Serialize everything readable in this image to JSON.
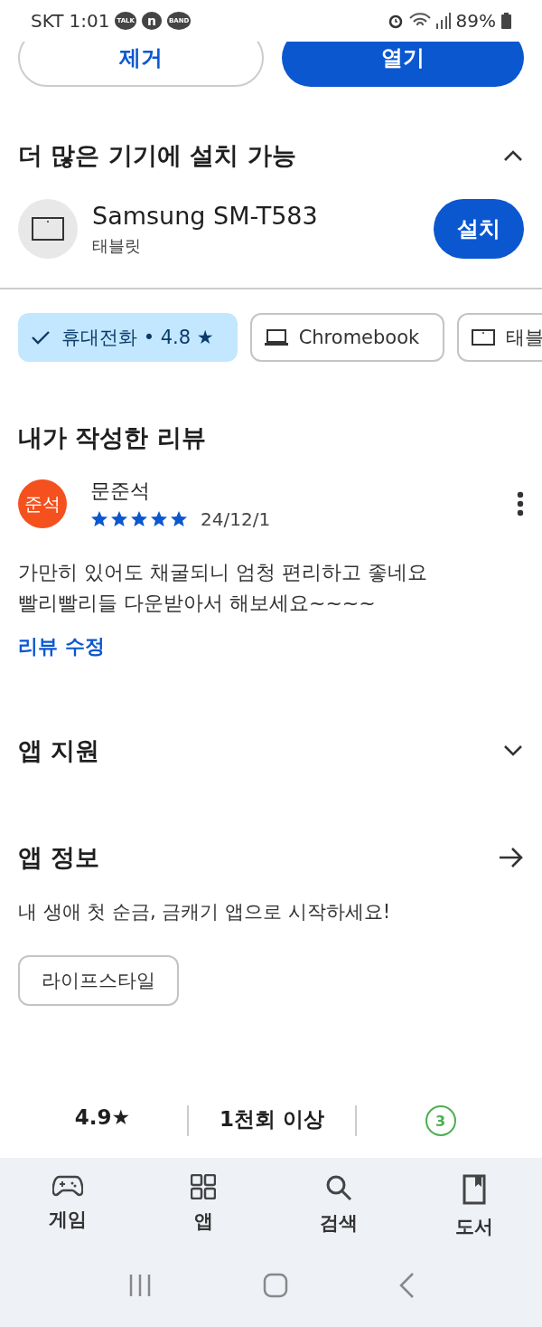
{
  "status_bar": {
    "carrier": "SKT",
    "time": "1:01",
    "notifications": [
      "TALK",
      "n",
      "BAND"
    ],
    "battery": "89%"
  },
  "action_buttons": [
    {
      "label": "제거",
      "kind": "outline"
    },
    {
      "label": "열기",
      "kind": "filled"
    }
  ],
  "devices_section": {
    "title": "더 많은 기기에 설치 가능",
    "expanded": true,
    "devices": [
      {
        "name": "Samsung SM-T583",
        "type": "태블릿",
        "button": "설치"
      }
    ]
  },
  "device_chips": [
    {
      "label": "휴대전화 • 4.8 ★",
      "selected": true
    },
    {
      "label": "Chromebook",
      "kind": "laptop",
      "selected": false
    },
    {
      "label": "태블",
      "kind": "tablet",
      "selected": false
    }
  ],
  "my_review": {
    "title": "내가 작성한 리뷰",
    "avatar": "준석",
    "author": "문준석",
    "stars": 5,
    "date": "24/12/1",
    "text": "가만히 있어도 채굴되니 엄청 편리하고 좋네요\n빨리빨리들 다운받아서 해보세요~~~~",
    "edit_link": "리뷰 수정"
  },
  "app_support": {
    "title": "앱 지원",
    "expanded": false
  },
  "app_info": {
    "title": "앱 정보",
    "description": "내 생애 첫 순금, 금캐기 앱으로 시작하세요!",
    "tag": "라이프스타일"
  },
  "stats": [
    {
      "kind": "rating",
      "value": "4.9★"
    },
    {
      "kind": "text",
      "value": "1천회 이상"
    },
    {
      "kind": "age",
      "value": "3"
    }
  ],
  "bottom_nav": [
    {
      "label": "게임",
      "kind": "game",
      "selected": false
    },
    {
      "label": "앱",
      "kind": "apps",
      "selected": false
    },
    {
      "label": "검색",
      "kind": "search",
      "selected": false
    },
    {
      "label": "도서",
      "kind": "book",
      "selected": false
    }
  ]
}
